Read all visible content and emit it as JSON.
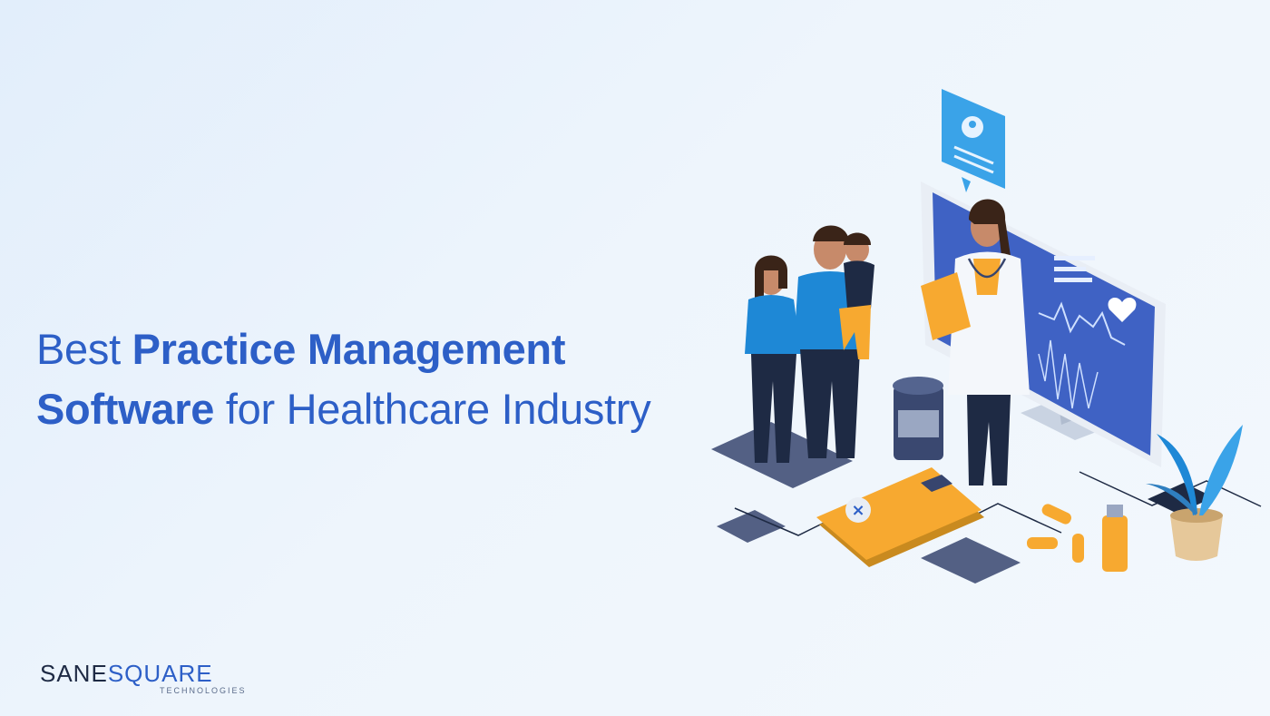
{
  "headline": {
    "line1_regular": "Best",
    "line1_bold": "Practice Management",
    "line2_bold": "Software",
    "line2_regular": "for Healthcare Industry"
  },
  "logo": {
    "part1": "SANE",
    "part2": "SQUARE",
    "sub": "TECHNOLOGIES"
  },
  "colors": {
    "brand_blue": "#2d5fc7",
    "dark_navy": "#1e2a44",
    "accent_orange": "#f7a930",
    "shirt_blue": "#1e88d6"
  },
  "illustration": {
    "icons": [
      "doctor-icon",
      "family-icon",
      "monitor-icon",
      "clipboard-icon",
      "profile-card-icon",
      "plant-icon",
      "pill-bottle-icon",
      "capsule-icon"
    ]
  }
}
